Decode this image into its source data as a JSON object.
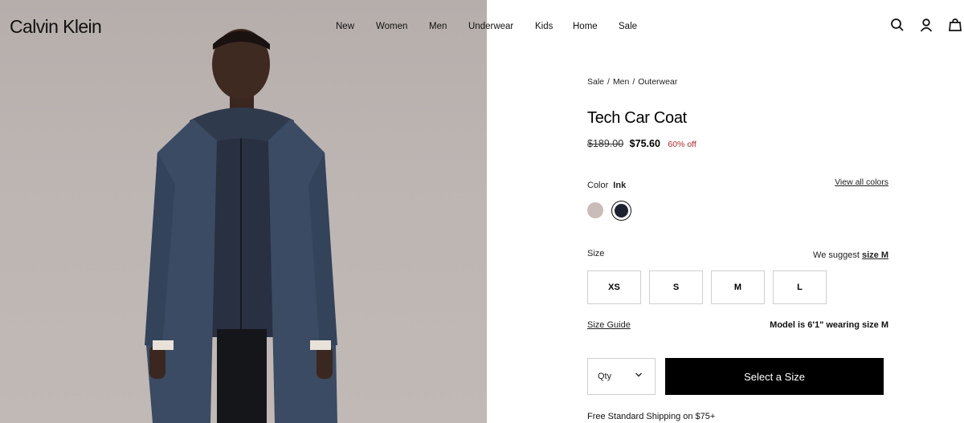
{
  "brand": {
    "logo": "Calvin Klein"
  },
  "nav": {
    "items": [
      {
        "label": "New"
      },
      {
        "label": "Women"
      },
      {
        "label": "Men"
      },
      {
        "label": "Underwear"
      },
      {
        "label": "Kids"
      },
      {
        "label": "Home"
      },
      {
        "label": "Sale"
      }
    ]
  },
  "header_icons": [
    "search-icon",
    "account-icon",
    "cart-icon"
  ],
  "product": {
    "breadcrumb": [
      "Sale",
      "Men",
      "Outerwear"
    ],
    "breadcrumb_separator": "/",
    "title": "Tech Car Coat",
    "price_original": "$189.00",
    "price_sale": "$75.60",
    "discount": "60% off",
    "discount_color": "#b3262b",
    "color_label": "Color",
    "color_value": "Ink",
    "view_all_colors": "View all colors",
    "swatches": [
      {
        "color": "#c9bcb9",
        "selected": false
      },
      {
        "color": "#1d2230",
        "selected": true
      }
    ],
    "size_label": "Size",
    "size_suggest_prefix": "We suggest",
    "size_suggest_link": "size M",
    "sizes": [
      "XS",
      "S",
      "M",
      "L"
    ],
    "size_guide": "Size Guide",
    "model_info": "Model is 6'1\" wearing size M",
    "qty_label": "Qty",
    "cta_label": "Select a Size",
    "shipping": "Free Standard Shipping on $75+"
  }
}
